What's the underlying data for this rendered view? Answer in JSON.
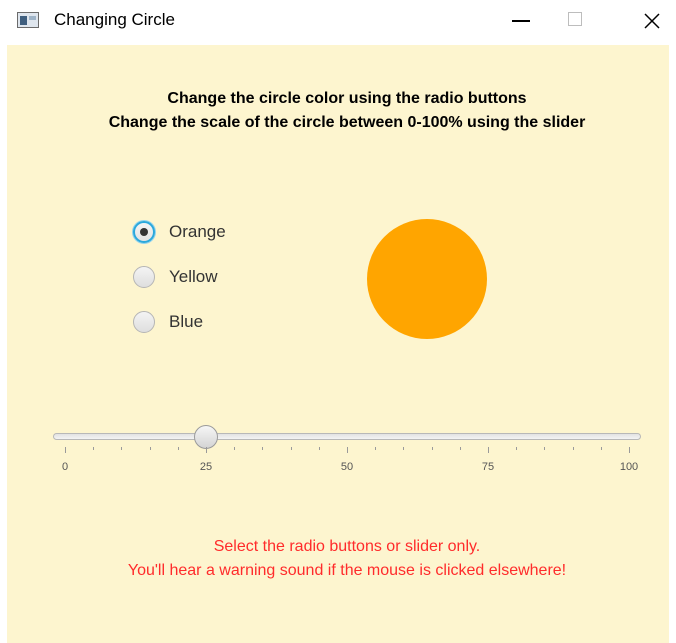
{
  "window": {
    "title": "Changing Circle"
  },
  "instructions": {
    "line1": "Change the circle color using the radio buttons",
    "line2": "Change the scale of the circle between 0-100% using the slider"
  },
  "radio_options": [
    {
      "label": "Orange",
      "selected": true
    },
    {
      "label": "Yellow",
      "selected": false
    },
    {
      "label": "Blue",
      "selected": false
    }
  ],
  "circle": {
    "color": "#ffa500"
  },
  "slider": {
    "min": 0,
    "max": 100,
    "value": 25,
    "major_ticks": [
      "0",
      "25",
      "50",
      "75",
      "100"
    ],
    "minor_tick_count": 4
  },
  "warning": {
    "line1": "Select the radio buttons or slider only.",
    "line2": "You'll hear a warning sound if the mouse is clicked elsewhere!",
    "color": "#ff2b2b"
  },
  "colors": {
    "background": "#fdf5cf",
    "accent": "#2aa8dc"
  }
}
